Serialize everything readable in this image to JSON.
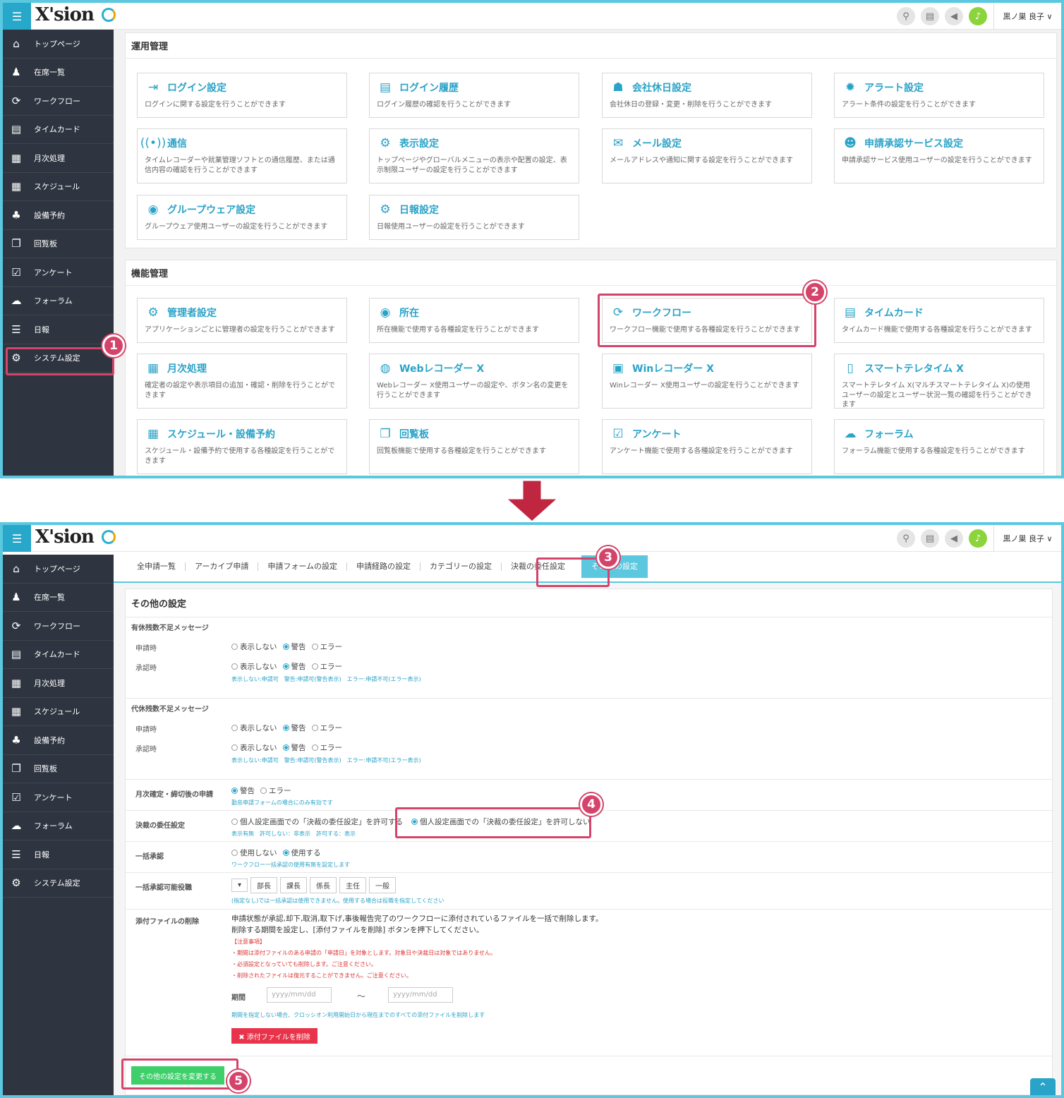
{
  "app": {
    "logo": "X'sion",
    "user": "黒ノ巣 良子 ∨"
  },
  "sidebar": [
    {
      "label": "トップページ",
      "icon": "home-icon",
      "glyph": "⌂"
    },
    {
      "label": "在席一覧",
      "icon": "person-icon",
      "glyph": "♟"
    },
    {
      "label": "ワークフロー",
      "icon": "workflow-icon",
      "glyph": "⟳"
    },
    {
      "label": "タイムカード",
      "icon": "timecard-icon",
      "glyph": "▤"
    },
    {
      "label": "月次処理",
      "icon": "calendar31-icon",
      "glyph": "▦"
    },
    {
      "label": "スケジュール",
      "icon": "schedule-icon",
      "glyph": "▦"
    },
    {
      "label": "設備予約",
      "icon": "facility-icon",
      "glyph": "♣"
    },
    {
      "label": "回覧板",
      "icon": "circular-icon",
      "glyph": "❐"
    },
    {
      "label": "アンケート",
      "icon": "survey-icon",
      "glyph": "☑"
    },
    {
      "label": "フォーラム",
      "icon": "forum-icon",
      "glyph": "☁"
    },
    {
      "label": "日報",
      "icon": "report-icon",
      "glyph": "☰"
    },
    {
      "label": "システム設定",
      "icon": "gear-icon",
      "glyph": "⚙"
    }
  ],
  "panel1": {
    "title": "運用管理",
    "cards": [
      {
        "title": "ログイン設定",
        "desc": "ログインに関する設定を行うことができます",
        "glyph": "⇥"
      },
      {
        "title": "ログイン履歴",
        "desc": "ログイン履歴の確認を行うことができます",
        "glyph": "▤"
      },
      {
        "title": "会社休日設定",
        "desc": "会社休日の登録・変更・削除を行うことができます",
        "glyph": "☗"
      },
      {
        "title": "アラート設定",
        "desc": "アラート条件の設定を行うことができます",
        "glyph": "✹"
      },
      {
        "title": "通信",
        "desc": "タイムレコーダーや就業管理ソフトとの通信履歴、または通信内容の確認を行うことができます",
        "glyph": "((•))"
      },
      {
        "title": "表示設定",
        "desc": "トップページやグローバルメニューの表示や配置の設定、表示制限ユーザーの設定を行うことができます",
        "glyph": "⚙"
      },
      {
        "title": "メール設定",
        "desc": "メールアドレスや通知に関する設定を行うことができます",
        "glyph": "✉"
      },
      {
        "title": "申請承認サービス設定",
        "desc": "申請承認サービス使用ユーザーの設定を行うことができます",
        "glyph": "☻"
      },
      {
        "title": "グループウェア設定",
        "desc": "グループウェア使用ユーザーの設定を行うことができます",
        "glyph": "◉"
      },
      {
        "title": "日報設定",
        "desc": "日報使用ユーザーの設定を行うことができます",
        "glyph": "⚙"
      }
    ]
  },
  "panel2": {
    "title": "機能管理",
    "cards": [
      {
        "title": "管理者設定",
        "desc": "アプリケーションごとに管理者の設定を行うことができます",
        "glyph": "⚙"
      },
      {
        "title": "所在",
        "desc": "所在機能で使用する各種設定を行うことができます",
        "glyph": "◉"
      },
      {
        "title": "ワークフロー",
        "desc": "ワークフロー機能で使用する各種設定を行うことができます",
        "glyph": "⟳"
      },
      {
        "title": "タイムカード",
        "desc": "タイムカード機能で使用する各種設定を行うことができます",
        "glyph": "▤"
      },
      {
        "title": "月次処理",
        "desc": "確定者の設定や表示項目の追加・確認・削除を行うことができます",
        "glyph": "▦"
      },
      {
        "title": "Webレコーダー X",
        "desc": "Webレコーダー X使用ユーザーの設定や、ボタン名の変更を行うことができます",
        "glyph": "◍"
      },
      {
        "title": "Winレコーダー X",
        "desc": "Winレコーダー X使用ユーザーの設定を行うことができます",
        "glyph": "▣"
      },
      {
        "title": "スマートテレタイム X",
        "desc": "スマートテレタイム X(マルチスマートテレタイム X)の使用ユーザーの設定とユーザー状況一覧の確認を行うことができます",
        "glyph": "▯"
      },
      {
        "title": "スケジュール・設備予約",
        "desc": "スケジュール・設備予約で使用する各種設定を行うことができます",
        "glyph": "▦"
      },
      {
        "title": "回覧板",
        "desc": "回覧板機能で使用する各種設定を行うことができます",
        "glyph": "❐"
      },
      {
        "title": "アンケート",
        "desc": "アンケート機能で使用する各種設定を行うことができます",
        "glyph": "☑"
      },
      {
        "title": "フォーラム",
        "desc": "フォーラム機能で使用する各種設定を行うことができます",
        "glyph": "☁"
      }
    ]
  },
  "markers": [
    "1",
    "2",
    "3",
    "4",
    "5"
  ],
  "tabs": [
    "全申請一覧",
    "アーカイブ申請",
    "申請フォームの設定",
    "申請経路の設定",
    "カテゴリーの設定",
    "決裁の委任設定",
    "その他の設定"
  ],
  "settings": {
    "title": "その他の設定",
    "paid_leave": {
      "head": "有休残数不足メッセージ",
      "row1": "申請時",
      "row2": "承認時",
      "opts": [
        "表示しない",
        "警告",
        "エラー"
      ],
      "hint": "表示しない:申請可　警告:申請可(警告表示)　エラー:申請不可(エラー表示)"
    },
    "sub_leave": {
      "head": "代休残数不足メッセージ",
      "row1": "申請時",
      "row2": "承認時",
      "opts": [
        "表示しない",
        "警告",
        "エラー"
      ],
      "hint": "表示しない:申請可　警告:申請可(警告表示)　エラー:申請不可(エラー表示)"
    },
    "monthly": {
      "label": "月次確定・締切後の申請",
      "opts": [
        "警告",
        "エラー"
      ],
      "hint": "勤怠申請フォームの場合にのみ有効です"
    },
    "delegation": {
      "label": "決裁の委任設定",
      "opt1": "個人設定画面での「決裁の委任設定」を許可する",
      "opt2": "個人設定画面での「決裁の委任設定」を許可しない",
      "hint": "表示有無　許可しない：非表示　許可する：表示"
    },
    "bulk": {
      "label": "一括承認",
      "opts": [
        "使用しない",
        "使用する"
      ],
      "hint": "ワークフロー一括承認の使用有無を設定します"
    },
    "bulk_roles": {
      "label": "一括承認可能役職",
      "dropdown": "▾",
      "roles": [
        "部長",
        "課長",
        "係長",
        "主任",
        "一般"
      ],
      "hint": "(指定なし)では一括承認は使用できません。使用する場合は役職を指定してください"
    },
    "attach": {
      "label": "添付ファイルの削除",
      "text1": "申請状態が承認,却下,取消,取下げ,事後報告完了のワークフローに添付されているファイルを一括で削除します。",
      "text2": "削除する期間を設定し、[添付ファイルを削除] ボタンを押下してください。",
      "note_head": "【注意事項】",
      "notes": [
        "・期間は添付ファイルのある申請の「申請日」を対象とします。対象日や決裁日は対象ではありません。",
        "・必須設定となっていても削除します。ご注意ください。",
        "・削除されたファイルは復元することができません。ご注意ください。"
      ],
      "period_label": "期間",
      "from_placeholder": "yyyy/mm/dd",
      "tilde": "～",
      "to_placeholder": "yyyy/mm/dd",
      "hint": "期間を指定しない場合、クロッシオン利用開始日から現在までのすべての添付ファイルを削除します",
      "delete_btn": "✖ 添付ファイルを削除"
    },
    "submit": "その他の設定を変更する"
  },
  "colors": {
    "accent": "#2aa3c8",
    "frame": "#5bc8e0",
    "marker": "#d4446a",
    "sidebar": "#2f3540"
  }
}
